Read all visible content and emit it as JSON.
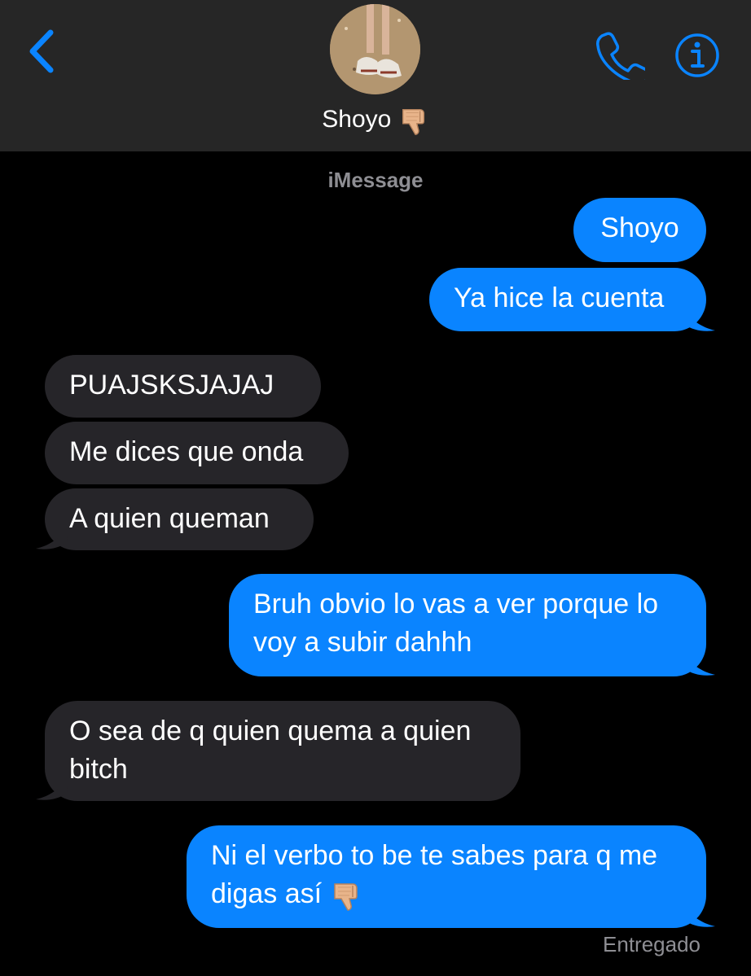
{
  "header": {
    "contact_name": "Shoyo",
    "back_icon": "chevron-left-icon",
    "call_icon": "phone-icon",
    "info_icon": "info-icon",
    "accent_color": "#0a84ff",
    "name_emoji": "thumbs-down-emoji"
  },
  "thread": {
    "service_label": "iMessage",
    "status": "Entregado"
  },
  "messages": [
    {
      "direction": "out",
      "lines": [
        "Shoyo"
      ]
    },
    {
      "direction": "out",
      "lines": [
        "Ya hice la cuenta"
      ]
    },
    {
      "direction": "in",
      "lines": [
        "PUAJSKSJAJAJ"
      ]
    },
    {
      "direction": "in",
      "lines": [
        "Me dices que onda"
      ]
    },
    {
      "direction": "in",
      "lines": [
        "A quien queman"
      ]
    },
    {
      "direction": "out",
      "lines": [
        "Bruh obvio lo vas a ver porque lo",
        "voy a subir dahhh"
      ]
    },
    {
      "direction": "in",
      "lines": [
        "O sea de q quien quema a quien",
        "bitch"
      ]
    },
    {
      "direction": "out",
      "lines": [
        "Ni el verbo to be te sabes para q me",
        "digas así"
      ],
      "trailing_emoji": "thumbs-down-emoji"
    }
  ],
  "colors": {
    "outgoing_bubble": "#0a84ff",
    "incoming_bubble": "#262529",
    "header_bg": "#262626",
    "muted_text": "#8e8e93"
  }
}
